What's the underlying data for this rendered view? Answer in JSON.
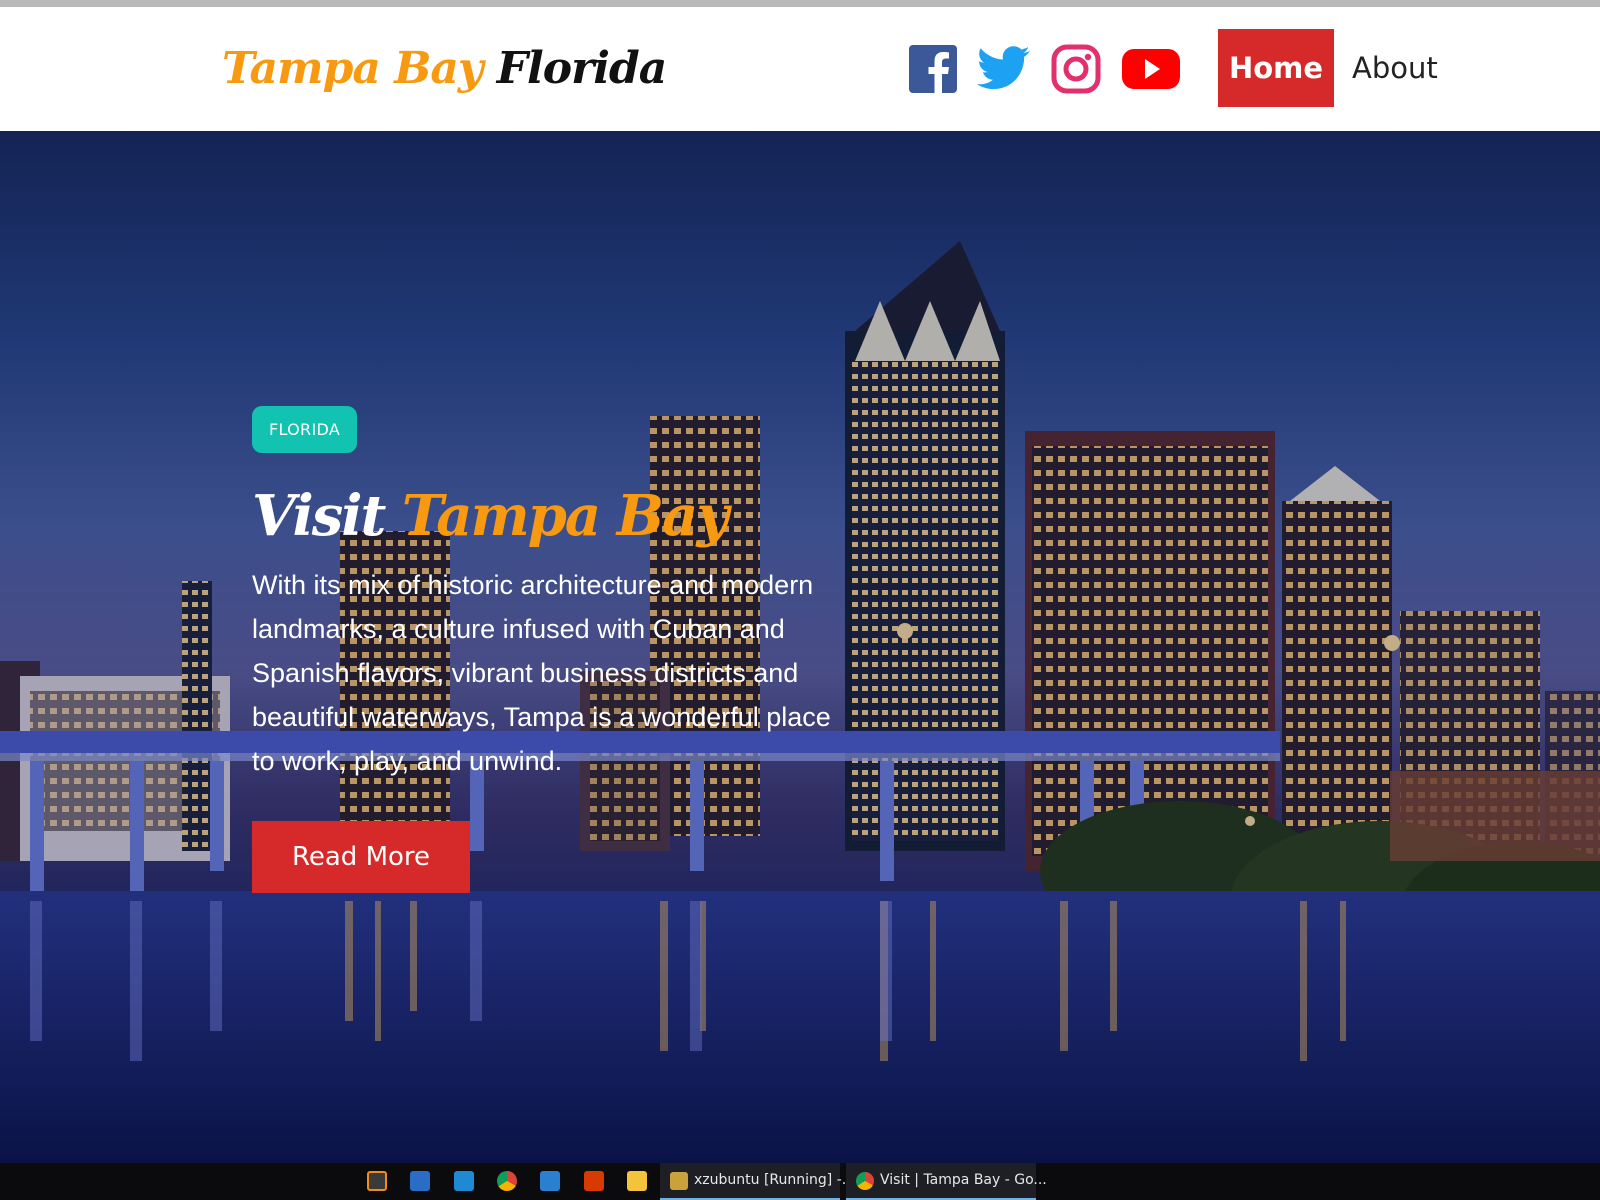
{
  "brand": {
    "part1": "Tampa Bay",
    "part2": "Florida"
  },
  "social": {
    "facebook": "facebook-icon",
    "twitter": "twitter-icon",
    "instagram": "instagram-icon",
    "youtube": "youtube-icon"
  },
  "nav": {
    "home": "Home",
    "about": "About"
  },
  "hero": {
    "tag": "FLORIDA",
    "title_part1": "Visit",
    "title_part2": "Tampa Bay",
    "description": "With its mix of historic architecture and modern landmarks, a culture infused with Cuban and Spanish flavors, vibrant business districts and beautiful waterways, Tampa is a wonderful place to work, play, and unwind.",
    "button": "Read More"
  },
  "taskbar": {
    "tasks": [
      {
        "label": "xzubuntu [Running] -..."
      },
      {
        "label": "Visit | Tampa Bay - Go..."
      }
    ]
  },
  "colors": {
    "accent_orange": "#f79a12",
    "accent_red": "#d62a2a",
    "tag_teal": "#12c3b1"
  }
}
